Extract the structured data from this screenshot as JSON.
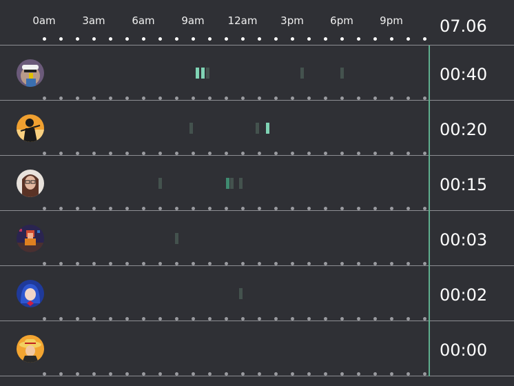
{
  "timeline": {
    "hour_labels": [
      "0am",
      "3am",
      "6am",
      "9am",
      "12am",
      "3pm",
      "6pm",
      "9pm"
    ],
    "date": "07.06"
  },
  "colors": {
    "background": "#2f3035",
    "divider": "#8e8f94",
    "now_line": "#5fae8e",
    "activity_strong": "#7fd3b4",
    "activity_mid": "#3f8a70",
    "activity_weak": "#44524e"
  },
  "rows": [
    {
      "total": "00:40",
      "avatar_icon": "avatar-sunglasses-icon",
      "activity": [
        {
          "hour": 9.25,
          "level": "strong"
        },
        {
          "hour": 9.6,
          "level": "strong"
        },
        {
          "hour": 9.9,
          "level": "weak"
        },
        {
          "hour": 15.6,
          "level": "weak"
        },
        {
          "hour": 18.0,
          "level": "weak"
        }
      ]
    },
    {
      "total": "00:20",
      "avatar_icon": "avatar-silhouette-sunset-icon",
      "activity": [
        {
          "hour": 8.9,
          "level": "weak"
        },
        {
          "hour": 12.9,
          "level": "weak"
        },
        {
          "hour": 13.5,
          "level": "strong"
        }
      ]
    },
    {
      "total": "00:15",
      "avatar_icon": "avatar-woman-glasses-icon",
      "activity": [
        {
          "hour": 7.0,
          "level": "weak"
        },
        {
          "hour": 11.1,
          "level": "mid"
        },
        {
          "hour": 11.35,
          "level": "weak"
        },
        {
          "hour": 11.9,
          "level": "weak"
        }
      ]
    },
    {
      "total": "00:03",
      "avatar_icon": "avatar-pixel-character-icon",
      "activity": [
        {
          "hour": 8.0,
          "level": "weak"
        }
      ]
    },
    {
      "total": "00:02",
      "avatar_icon": "avatar-anime-blue-hair-icon",
      "activity": [
        {
          "hour": 11.9,
          "level": "weak"
        }
      ]
    },
    {
      "total": "00:00",
      "avatar_icon": "avatar-anime-straw-hat-icon",
      "activity": []
    }
  ]
}
